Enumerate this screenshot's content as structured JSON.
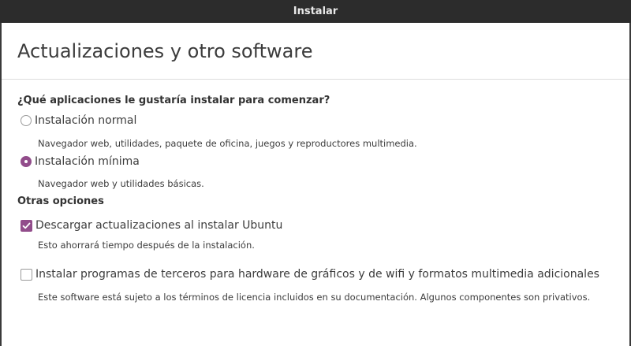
{
  "window": {
    "title": "Instalar"
  },
  "page": {
    "title": "Actualizaciones y otro software"
  },
  "install_type": {
    "question": "¿Qué aplicaciones le gustaría instalar para comenzar?",
    "options": [
      {
        "label": "Instalación normal",
        "description": "Navegador web, utilidades, paquete de oficina, juegos y reproductores multimedia.",
        "selected": false
      },
      {
        "label": "Instalación mínima",
        "description": "Navegador web y utilidades básicas.",
        "selected": true
      }
    ]
  },
  "other_options": {
    "title": "Otras opciones",
    "items": [
      {
        "label": "Descargar actualizaciones al instalar Ubuntu",
        "description": "Esto ahorrará tiempo después de la instalación.",
        "checked": true
      },
      {
        "label": "Instalar programas de terceros para hardware de gráficos y de wifi y formatos multimedia adicionales",
        "description": "Este software está sujeto a los términos de licencia incluidos en su documentación. Algunos componentes son privativos.",
        "checked": false
      }
    ]
  },
  "colors": {
    "titlebar": "#2c2c2c",
    "accent": "#924d8b",
    "text": "#3c3c3c"
  }
}
